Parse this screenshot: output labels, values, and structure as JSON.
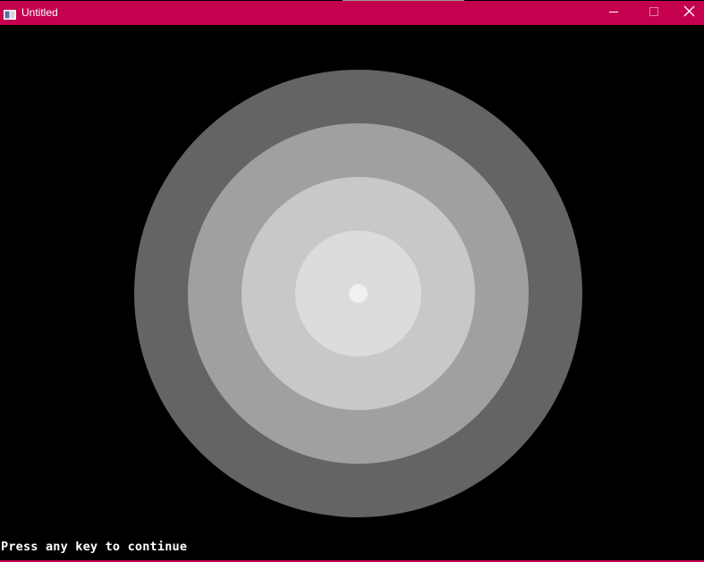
{
  "window": {
    "title": "Untitled",
    "accent_color": "#c4004f",
    "controls": {
      "minimize_icon": "minimize-icon",
      "maximize_icon": "maximize-icon",
      "close_icon": "close-icon"
    }
  },
  "canvas": {
    "background": "#000000",
    "rings": [
      {
        "color": "#646464"
      },
      {
        "color": "#a0a0a0"
      },
      {
        "color": "#c8c8c8"
      },
      {
        "color": "#dcdcdc"
      },
      {
        "color": "#f0f0f0"
      }
    ],
    "prompt": "Press any key to continue"
  }
}
